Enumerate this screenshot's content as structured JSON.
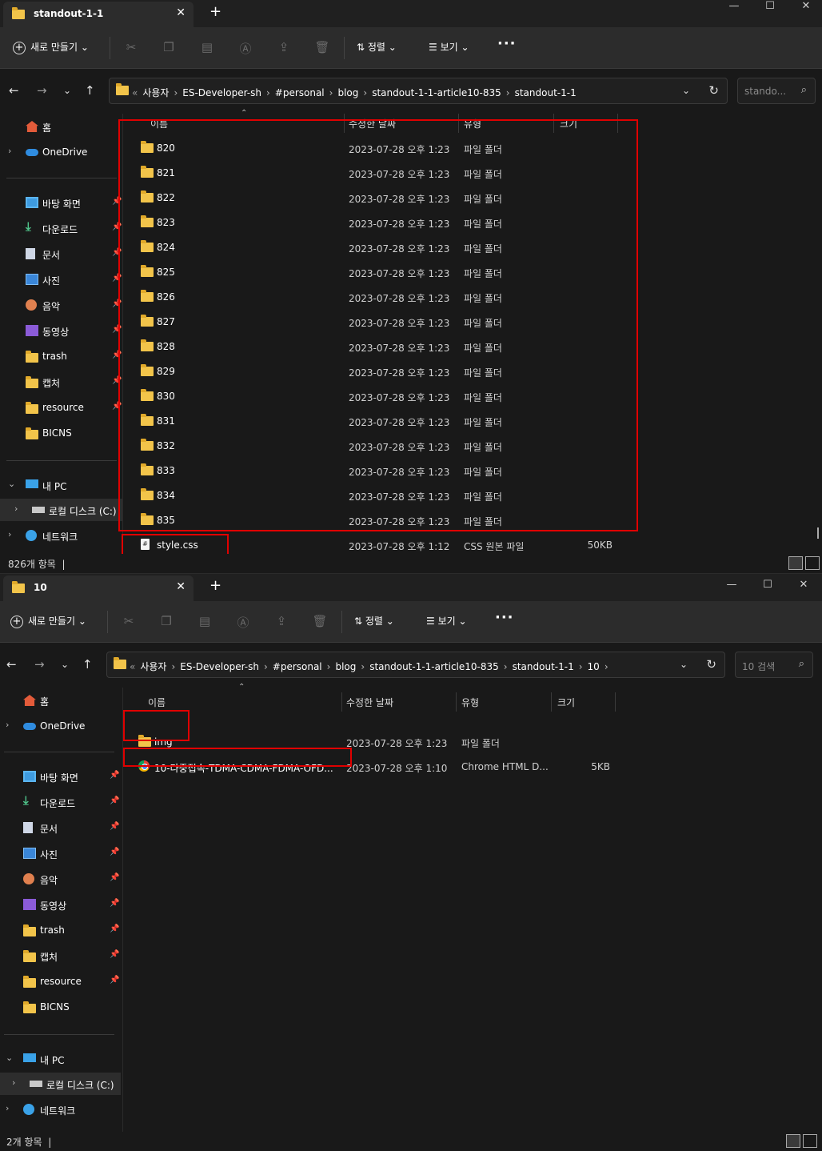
{
  "window1": {
    "tab_title": "standout-1-1",
    "toolbar": {
      "new_label": "새로 만들기",
      "sort_label": "정렬",
      "view_label": "보기"
    },
    "breadcrumb": [
      "사용자",
      "ES-Developer-sh",
      "#personal",
      "blog",
      "standout-1-1-article10-835",
      "standout-1-1"
    ],
    "search_placeholder": "stando...",
    "columns": {
      "name": "이름",
      "date": "수정한 날짜",
      "type": "유형",
      "size": "크기"
    },
    "rows": [
      {
        "name": "820",
        "date": "2023-07-28 오후 1:23",
        "type": "파일 폴더",
        "size": "",
        "icon": "folder-icon"
      },
      {
        "name": "821",
        "date": "2023-07-28 오후 1:23",
        "type": "파일 폴더",
        "size": "",
        "icon": "folder-icon"
      },
      {
        "name": "822",
        "date": "2023-07-28 오후 1:23",
        "type": "파일 폴더",
        "size": "",
        "icon": "folder-icon"
      },
      {
        "name": "823",
        "date": "2023-07-28 오후 1:23",
        "type": "파일 폴더",
        "size": "",
        "icon": "folder-icon"
      },
      {
        "name": "824",
        "date": "2023-07-28 오후 1:23",
        "type": "파일 폴더",
        "size": "",
        "icon": "folder-icon"
      },
      {
        "name": "825",
        "date": "2023-07-28 오후 1:23",
        "type": "파일 폴더",
        "size": "",
        "icon": "folder-icon"
      },
      {
        "name": "826",
        "date": "2023-07-28 오후 1:23",
        "type": "파일 폴더",
        "size": "",
        "icon": "folder-icon"
      },
      {
        "name": "827",
        "date": "2023-07-28 오후 1:23",
        "type": "파일 폴더",
        "size": "",
        "icon": "folder-icon"
      },
      {
        "name": "828",
        "date": "2023-07-28 오후 1:23",
        "type": "파일 폴더",
        "size": "",
        "icon": "folder-icon"
      },
      {
        "name": "829",
        "date": "2023-07-28 오후 1:23",
        "type": "파일 폴더",
        "size": "",
        "icon": "folder-icon"
      },
      {
        "name": "830",
        "date": "2023-07-28 오후 1:23",
        "type": "파일 폴더",
        "size": "",
        "icon": "folder-icon"
      },
      {
        "name": "831",
        "date": "2023-07-28 오후 1:23",
        "type": "파일 폴더",
        "size": "",
        "icon": "folder-icon"
      },
      {
        "name": "832",
        "date": "2023-07-28 오후 1:23",
        "type": "파일 폴더",
        "size": "",
        "icon": "folder-icon"
      },
      {
        "name": "833",
        "date": "2023-07-28 오후 1:23",
        "type": "파일 폴더",
        "size": "",
        "icon": "folder-icon"
      },
      {
        "name": "834",
        "date": "2023-07-28 오후 1:23",
        "type": "파일 폴더",
        "size": "",
        "icon": "folder-icon"
      },
      {
        "name": "835",
        "date": "2023-07-28 오후 1:23",
        "type": "파일 폴더",
        "size": "",
        "icon": "folder-icon"
      },
      {
        "name": "style.css",
        "date": "2023-07-28 오후 1:12",
        "type": "CSS 원본 파일",
        "size": "50KB",
        "icon": "css-file-icon"
      }
    ],
    "status": "826개 항목"
  },
  "window2": {
    "tab_title": "10",
    "toolbar": {
      "new_label": "새로 만들기",
      "sort_label": "정렬",
      "view_label": "보기"
    },
    "breadcrumb": [
      "사용자",
      "ES-Developer-sh",
      "#personal",
      "blog",
      "standout-1-1-article10-835",
      "standout-1-1",
      "10"
    ],
    "search_placeholder": "10 검색",
    "columns": {
      "name": "이름",
      "date": "수정한 날짜",
      "type": "유형",
      "size": "크기"
    },
    "rows": [
      {
        "name": "img",
        "date": "2023-07-28 오후 1:23",
        "type": "파일 폴더",
        "size": "",
        "icon": "folder-icon"
      },
      {
        "name": "10-다중접속-TDMA-CDMA-FDMA-OFD...",
        "date": "2023-07-28 오후 1:10",
        "type": "Chrome HTML D...",
        "size": "5KB",
        "icon": "chrome-icon"
      }
    ],
    "status": "2개 항목"
  },
  "sidebar": {
    "home": "홈",
    "onedrive": "OneDrive",
    "quick": [
      {
        "label": "바탕 화면",
        "icon": "desktop-icon",
        "pinned": true
      },
      {
        "label": "다운로드",
        "icon": "download-icon",
        "pinned": true
      },
      {
        "label": "문서",
        "icon": "documents-icon",
        "pinned": true
      },
      {
        "label": "사진",
        "icon": "pictures-icon",
        "pinned": true
      },
      {
        "label": "음악",
        "icon": "music-icon",
        "pinned": true
      },
      {
        "label": "동영상",
        "icon": "videos-icon",
        "pinned": true
      },
      {
        "label": "trash",
        "icon": "folder-icon",
        "pinned": true
      },
      {
        "label": "캡처",
        "icon": "folder-icon",
        "pinned": true
      },
      {
        "label": "resource",
        "icon": "folder-icon",
        "pinned": true
      },
      {
        "label": "BICNS",
        "icon": "folder-icon",
        "pinned": false
      }
    ],
    "this_pc": "내 PC",
    "local_disk": "로컬 디스크 (C:)",
    "network": "네트워크"
  },
  "colors": {
    "highlight_box": "#e00000",
    "folder": "#f2c44a",
    "background": "#191919"
  }
}
